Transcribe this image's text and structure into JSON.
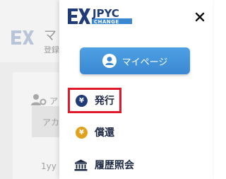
{
  "background": {
    "title": "マ",
    "subtitle": "登録",
    "card_title": "ア",
    "row1": "アカ",
    "row2": "1yy"
  },
  "drawer": {
    "logo_text": "JPYC",
    "logo_sub": "CHANGE",
    "close_icon": "close-icon",
    "mypage_label": "マイページ",
    "menu": [
      {
        "label": "発行",
        "icon": "¥",
        "icon_color": "#1f3b78",
        "highlighted": true
      },
      {
        "label": "償還",
        "icon": "¥",
        "icon_color": "#e0a21a",
        "highlighted": false
      },
      {
        "label": "履歴照会",
        "icon": "bank-icon",
        "highlighted": false
      }
    ]
  },
  "colors": {
    "brand_navy": "#1f3b78",
    "button_blue": "#3a88d2",
    "highlight_red": "#e11a2b",
    "coin_gold": "#e0a21a"
  }
}
